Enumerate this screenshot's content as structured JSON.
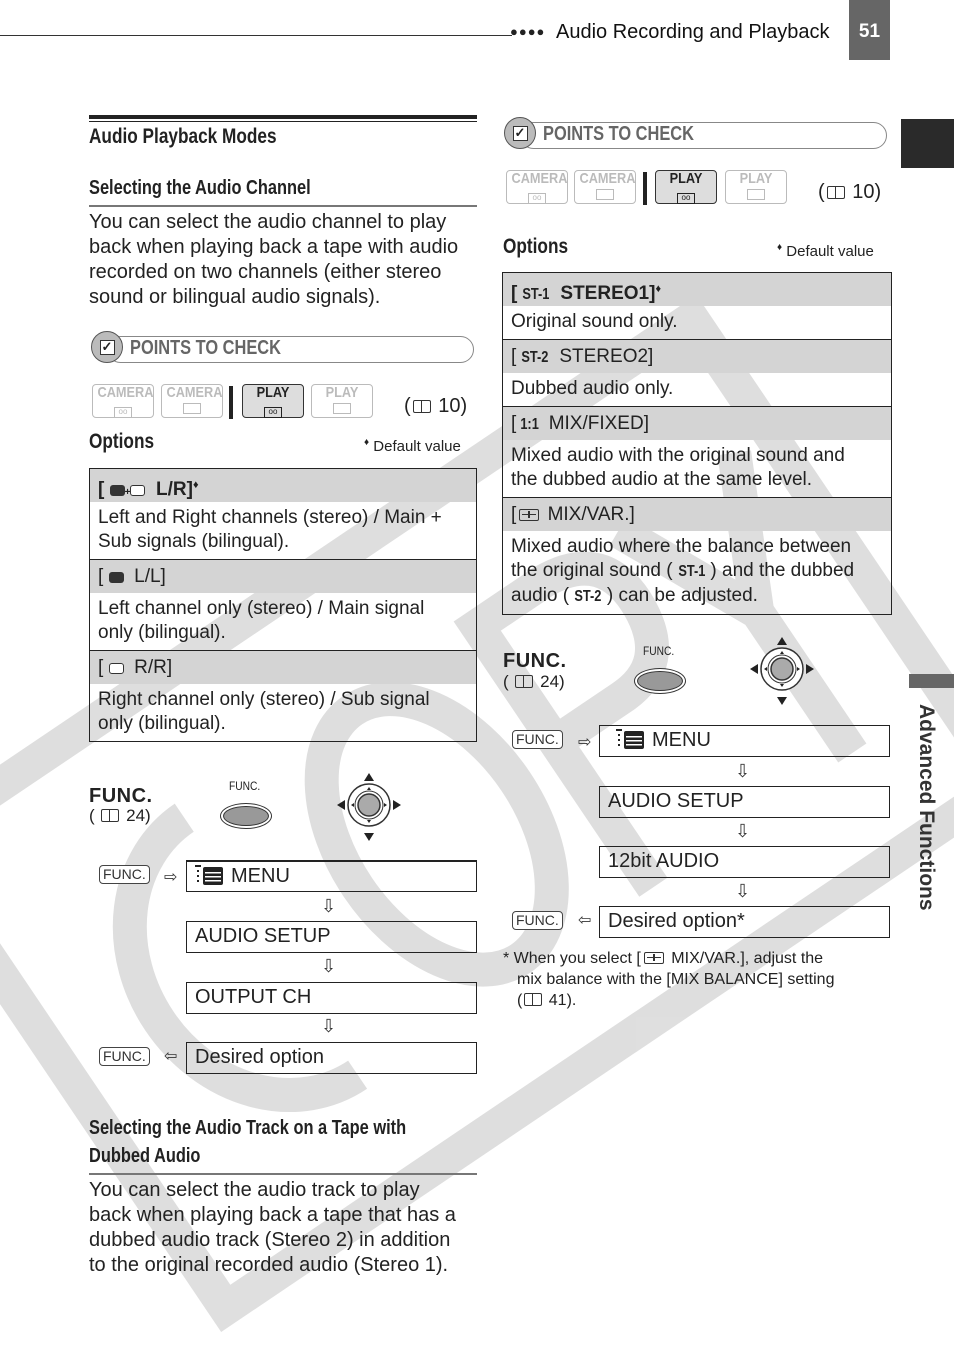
{
  "header": {
    "section_title": "Audio Recording and Playback",
    "page_number": "51",
    "dots": "●●●●"
  },
  "side_tab": {
    "label": "Advanced Functions"
  },
  "left": {
    "title": "Audio Playback Modes",
    "channel": {
      "heading": "Selecting the Audio Channel",
      "body_lines": [
        "You can select the audio channel to play",
        "back when playing back a tape with audio",
        "recorded on two channels (either stereo",
        "sound or bilingual audio signals)."
      ]
    },
    "points_to_check": {
      "label": "POINTS TO CHECK",
      "modes": [
        {
          "label": "CAMERA",
          "icon": "tape-icon",
          "active": false
        },
        {
          "label": "CAMERA",
          "icon": "card-icon",
          "active": false
        },
        {
          "label": "PLAY",
          "icon": "tape-icon",
          "active": true
        },
        {
          "label": "PLAY",
          "icon": "card-icon",
          "active": false
        }
      ],
      "ref_page": "10"
    },
    "options_label": "Options",
    "default_note": "Default value",
    "options": [
      {
        "icon": "main-sub-bubbles-icon",
        "name": "L/R]",
        "default": true,
        "desc": [
          "Left and Right channels (stereo) / Main +",
          "Sub signals (bilingual)."
        ]
      },
      {
        "icon": "main-bubble-icon",
        "name": "L/L]",
        "default": false,
        "desc": [
          "Left channel only (stereo) / Main signal",
          "only (bilingual)."
        ]
      },
      {
        "icon": "sub-bubble-icon",
        "name": "R/R]",
        "default": false,
        "desc": [
          "Right channel only (stereo) / Sub signal",
          "only (bilingual)."
        ]
      }
    ],
    "func": {
      "title": "FUNC.",
      "ref_page": "24",
      "button_label": "FUNC.",
      "tag": "FUNC.",
      "steps": [
        "MENU",
        "AUDIO  SETUP",
        "OUTPUT CH",
        "Desired option"
      ]
    },
    "track": {
      "heading_lines": [
        "Selecting the Audio Track on a Tape with",
        "Dubbed Audio"
      ],
      "body_lines": [
        "You can select the audio track to play",
        "back when playing back a tape that has a",
        "dubbed audio track (Stereo 2) in addition",
        "to the original recorded audio (Stereo 1)."
      ]
    }
  },
  "right": {
    "points_to_check": {
      "label": "POINTS TO CHECK",
      "modes": [
        {
          "label": "CAMERA",
          "icon": "tape-icon",
          "active": false
        },
        {
          "label": "CAMERA",
          "icon": "card-icon",
          "active": false
        },
        {
          "label": "PLAY",
          "icon": "tape-icon",
          "active": true
        },
        {
          "label": "PLAY",
          "icon": "card-icon",
          "active": false
        }
      ],
      "ref_page": "10"
    },
    "options_label": "Options",
    "default_note": "Default value",
    "options": [
      {
        "glyph": "ST-1",
        "name": "STEREO1]",
        "default": true,
        "desc": [
          "Original sound only."
        ]
      },
      {
        "glyph": "ST-2",
        "name": "STEREO2]",
        "default": false,
        "desc": [
          "Dubbed audio only."
        ]
      },
      {
        "glyph": "1:1",
        "name": "MIX/FIXED]",
        "default": false,
        "desc": [
          "Mixed audio with the original sound and",
          "the dubbed audio at the same level."
        ]
      },
      {
        "glyph": "mix-var",
        "name": "MIX/VAR.]",
        "default": false,
        "desc_parts": {
          "l1": "Mixed audio where the balance between",
          "l2a": "the original sound (",
          "l2g": "ST-1",
          "l2b": ") and the dubbed",
          "l3a": "audio (",
          "l3g": "ST-2",
          "l3b": ") can be adjusted."
        }
      }
    ],
    "func": {
      "title": "FUNC.",
      "ref_page": "24",
      "button_label": "FUNC.",
      "tag": "FUNC.",
      "steps": [
        "MENU",
        "AUDIO  SETUP",
        "12bit AUDIO",
        "Desired option*"
      ]
    },
    "footnote": {
      "prefix": "* When you select [",
      "item": "MIX/VAR.], adjust the",
      "line2": "mix balance with the [MIX BALANCE] setting",
      "ref_prefix": "(",
      "ref_page": "41).",
      "ref_suffix": ""
    }
  },
  "watermark": {
    "text": "COPY"
  }
}
